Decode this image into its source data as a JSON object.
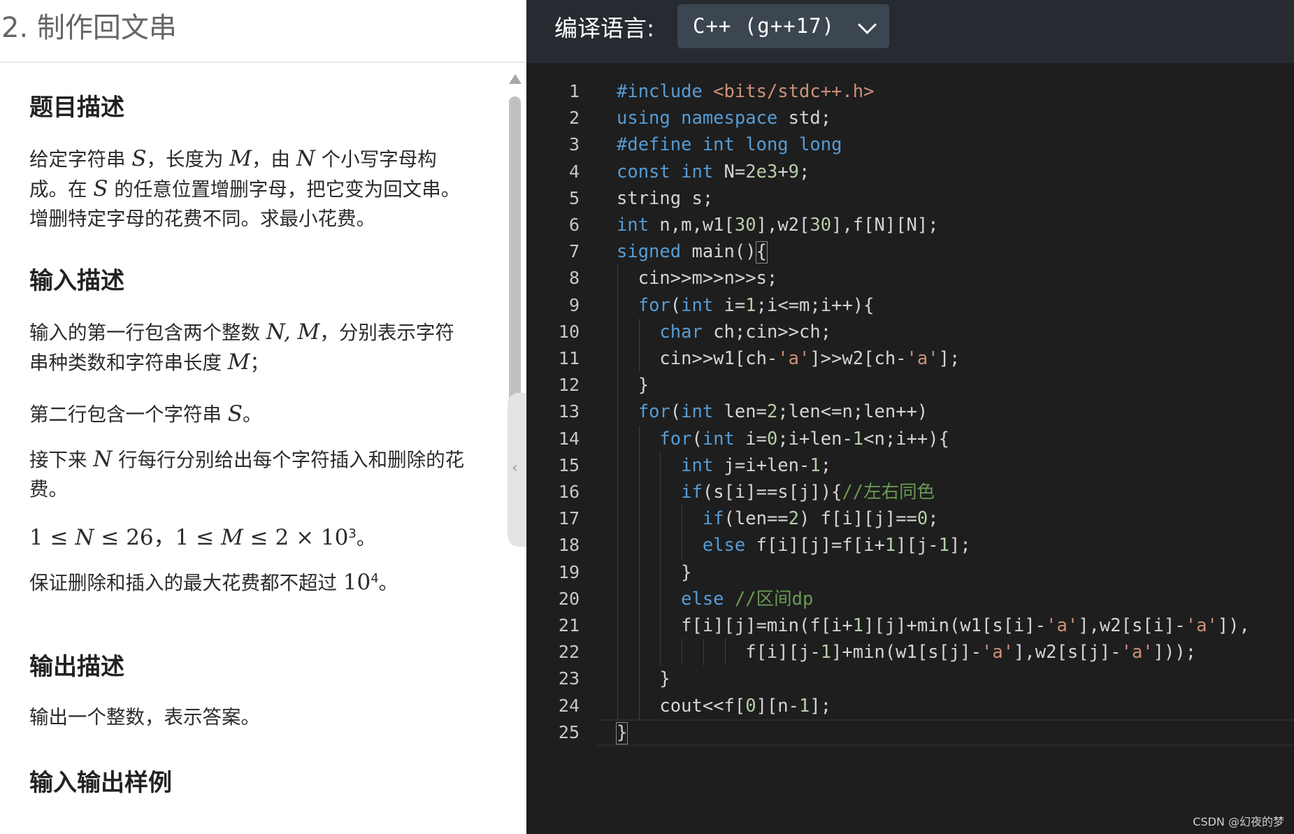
{
  "problem": {
    "title": "2. 制作回文串",
    "sections": {
      "description_heading": "题目描述",
      "input_heading": "输入描述",
      "output_heading": "输出描述",
      "sample_heading": "输入输出样例"
    },
    "description": {
      "p1_a": "给定字符串 ",
      "p1_S": "S",
      "p1_b": "，长度为 ",
      "p1_M": "M",
      "p1_c": "，由 ",
      "p1_N": "N",
      "p1_d": " 个小写字母构",
      "p2_a": "成。在 ",
      "p2_S": "S",
      "p2_b": " 的任意位置增删字母，把它变为回文串。",
      "p3": "增删特定字母的花费不同。求最小花费。"
    },
    "input": {
      "l1_a": "输入的第一行包含两个整数 ",
      "l1_NM": "N, M",
      "l1_b": "，分别表示字符",
      "l2_a": "串种类数和字符串长度 ",
      "l2_M": "M",
      "l2_b": "；",
      "line2_a": "第二行包含一个字符串 ",
      "line2_S": "S",
      "line2_b": "。",
      "line3_a": "接下来 ",
      "line3_N": "N",
      "line3_b": " 行每行分别给出每个字符插入和删除的花",
      "line3_c": "费。",
      "constraint_a": "1 ≤ ",
      "constraint_N": "N",
      "constraint_b": " ≤ 26，1 ≤ ",
      "constraint_M": "M",
      "constraint_c": " ≤ 2 × 10",
      "constraint_exp": "3",
      "constraint_end": "。",
      "guarantee_a": "保证删除和插入的最大花费都不超过 ",
      "guarantee_base": "10",
      "guarantee_exp": "4",
      "guarantee_end": "。"
    },
    "output": {
      "text": "输出一个整数，表示答案。"
    }
  },
  "editor": {
    "language_label": "编译语言:",
    "language_value": "C++ (g++17)",
    "line_numbers": [
      "1",
      "2",
      "3",
      "4",
      "5",
      "6",
      "7",
      "8",
      "9",
      "10",
      "11",
      "12",
      "13",
      "14",
      "15",
      "16",
      "17",
      "18",
      "19",
      "20",
      "21",
      "22",
      "23",
      "24",
      "25"
    ],
    "code_lines": [
      "#include <bits/stdc++.h>",
      "using namespace std;",
      "#define int long long",
      "const int N=2e3+9;",
      "string s;",
      "int n,m,w1[30],w2[30],f[N][N];",
      "signed main(){",
      "  cin>>m>>n>>s;",
      "  for(int i=1;i<=m;i++){",
      "    char ch;cin>>ch;",
      "    cin>>w1[ch-'a']>>w2[ch-'a'];",
      "  }",
      "  for(int len=2;len<=n;len++)",
      "    for(int i=0;i+len-1<n;i++){",
      "      int j=i+len-1;",
      "      if(s[i]==s[j]){//左右同色",
      "        if(len==2) f[i][j]==0;",
      "        else f[i][j]=f[i+1][j-1];",
      "      }",
      "      else //区间dp",
      "      f[i][j]=min(f[i+1][j]+min(w1[s[i]-'a'],w2[s[i]-'a']),",
      "            f[i][j-1]+min(w1[s[j]-'a'],w2[s[j]-'a']));",
      "    }",
      "    cout<<f[0][n-1];",
      "}"
    ]
  },
  "watermark": "CSDN @幻夜的梦",
  "colors": {
    "keyword": "#569cd6",
    "string": "#ce9178",
    "number": "#b5cea8",
    "comment": "#6a9955",
    "editor_bg": "#1e1e1e",
    "toolbar_bg": "#252b31",
    "select_bg": "#3b4650"
  }
}
